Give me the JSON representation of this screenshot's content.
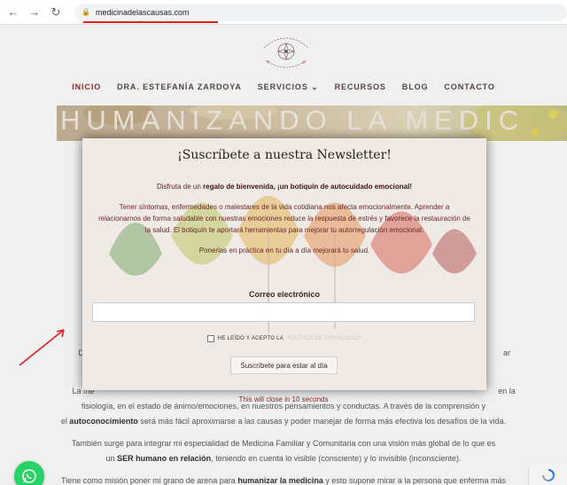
{
  "browser": {
    "back_icon": "arrow-left-icon",
    "forward_icon": "arrow-right-icon",
    "reload_icon": "reload-icon",
    "url": "medicinadelascausas.com"
  },
  "nav": {
    "items": [
      "INICIO",
      "DRA. ESTEFANÍA ZARDOYA",
      "SERVICIOS ⌄",
      "RECURSOS",
      "BLOG",
      "CONTACTO"
    ],
    "active": "INICIO"
  },
  "hero": {
    "title": "HUMANIZANDO LA MEDIC"
  },
  "modal": {
    "title": "¡Suscríbete a nuestra Newsletter!",
    "gift_prefix": "Disfruta de un ",
    "gift_bold": "regalo de bienvenida, ¡un botiquín de autocuidado emocional!",
    "desc_1": "Tener  síntomas,  enfermedades o malestares de la vida cotidiana nos afecta emocionalmente. Aprender a",
    "desc_2": "relacionarnos de forma saludable con nuestras emociones reduce la respuesta de estrés y favorece la restauración de",
    "desc_3": "la salud. El botiquín te aportará herramientas para mejorar tu autorregulación emocional.",
    "practice": "Ponerlas en práctica en tu día a día mejorará tu salud.",
    "email_label": "Correo electrónico",
    "email_value": "",
    "consent_prefix": "HE LEÍDO Y ACEPTO LA ",
    "consent_link": "POLÍTICA DE PRIVACIDAD*",
    "submit_label": "Suscríbete para estar al día"
  },
  "closes_text": "This will close in 10 seconds",
  "body": {
    "left_fragment": "De",
    "right_fragment": "ar",
    "line1_a": "La me",
    "line1_b": "en la",
    "line2": "fisiología, en el estado de ánimo/emociones, en nuestros pensamientos y conductas. A través de la comprensión y",
    "line3_bold": "autoconocimiento",
    "line3_pre": "el ",
    "line3_post": " será más fácil aproximarse a las causas y poder manejar de forma más efectiva los desafíos de la vida.",
    "line4": "También surge para integrar mi especialidad de Medicina Familiar y Comunitaria con una visión más global de lo que es",
    "line5_pre": "un ",
    "line5_bold": "SER humano en relación",
    "line5_post": ", teniendo en cuenta lo visible (consciente) y lo invisible (inconsciente).",
    "line6_pre": "Tiene como misión poner mi grano de arena para ",
    "line6_bold": "humanizar la medicina",
    "line6_post": " y esto supone mirar a la persona que enferma más"
  },
  "colors": {
    "accent": "#9b2d2d",
    "whatsapp": "#25d366",
    "annotation": "#e41e1e"
  },
  "icons": {
    "whatsapp": "whatsapp-icon",
    "recaptcha": "recaptcha-icon",
    "lock": "lock-icon"
  }
}
